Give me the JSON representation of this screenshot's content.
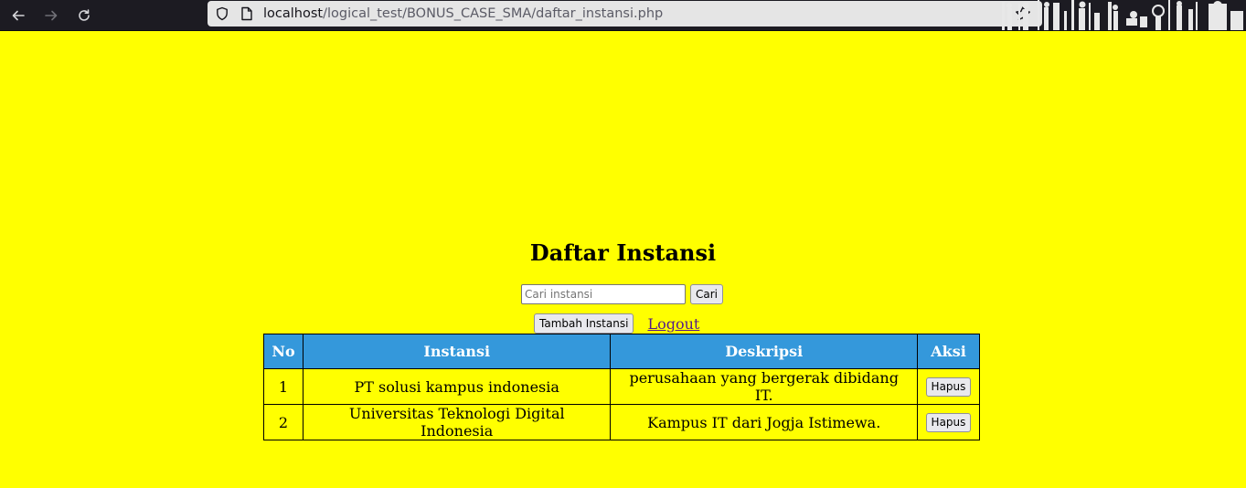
{
  "browser": {
    "url_host": "localhost",
    "url_path": "/logical_test/BONUS_CASE_SMA/daftar_instansi.php"
  },
  "page": {
    "title": "Daftar Instansi",
    "search": {
      "placeholder": "Cari instansi",
      "value": "",
      "button_label": "Cari"
    },
    "add_button_label": "Tambah Instansi",
    "logout_label": "Logout"
  },
  "table": {
    "headers": [
      "No",
      "Instansi",
      "Deskripsi",
      "Aksi"
    ],
    "rows": [
      {
        "no": "1",
        "instansi": "PT solusi kampus indonesia",
        "deskripsi": "perusahaan yang bergerak dibidang IT.",
        "action_label": "Hapus"
      },
      {
        "no": "2",
        "instansi": "Universitas Teknologi Digital Indonesia",
        "deskripsi": "Kampus IT dari Jogja Istimewa.",
        "action_label": "Hapus"
      }
    ]
  },
  "colors": {
    "page_background": "#ffff00",
    "table_header": "#3498db"
  }
}
